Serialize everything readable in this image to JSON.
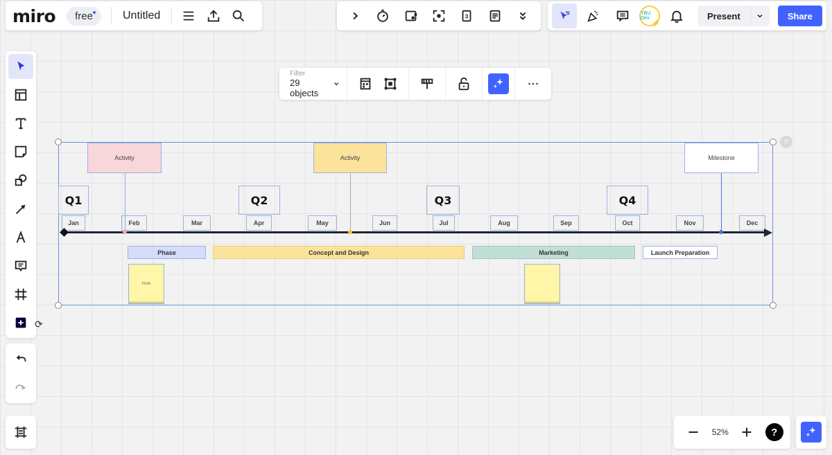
{
  "header": {
    "logo": "miro",
    "plan_badge": "free",
    "board_title": "Untitled",
    "left_icons": [
      "menu-icon",
      "upload-icon",
      "search-icon"
    ]
  },
  "center_toolbar": {
    "icons": [
      "chevron-right-icon",
      "timer-icon",
      "card-icon",
      "focus-icon",
      "calendar-icon",
      "notes-icon",
      "chevrons-down-icon"
    ]
  },
  "right_toolbar": {
    "icons": [
      "cursor-tracking-icon",
      "celebrate-icon",
      "comments-icon",
      "avatar",
      "bell-icon"
    ],
    "avatar_text": "YBU Dev",
    "present_label": "Present",
    "share_label": "Share",
    "accent_color": "#4262ff"
  },
  "context_toolbar": {
    "filter_label": "Filter",
    "filter_value": "29 objects",
    "icons": [
      "grid-layout-icon",
      "fit-frame-icon",
      "paint-format-icon",
      "unlock-icon",
      "ai-sparkle-icon",
      "more-icon"
    ]
  },
  "left_toolbar": {
    "tools": [
      "select-icon",
      "templates-icon",
      "text-icon",
      "sticky-note-icon",
      "shapes-icon",
      "arrow-icon",
      "pen-icon",
      "comment-icon",
      "frame-icon",
      "more-apps-icon"
    ],
    "active_tool": "select"
  },
  "history": {
    "undo": "undo-icon",
    "redo": "redo-icon"
  },
  "bottom_right": {
    "zoom_level": "52%",
    "help_label": "?"
  },
  "timeline": {
    "quarters": [
      "Q1",
      "Q2",
      "Q3",
      "Q4"
    ],
    "months": [
      "Jan",
      "Feb",
      "Mar",
      "Apr",
      "May",
      "Jun",
      "Jul",
      "Aug",
      "Sep",
      "Oct",
      "Nov",
      "Dec"
    ],
    "events": [
      {
        "label": "Activity",
        "color": "#f8d7da"
      },
      {
        "label": "Activity",
        "color": "#fbe39b"
      },
      {
        "label": "Milestone",
        "color": "#ffffff"
      }
    ],
    "phases": [
      {
        "label": "Phase",
        "color": "#d5dcfa"
      },
      {
        "label": "Concept and Design",
        "color": "#fbe39b"
      },
      {
        "label": "Marketing",
        "color": "#c2dfd7"
      },
      {
        "label": "Launch Preparation",
        "color": "#ffffff"
      }
    ],
    "notes": [
      {
        "label": "Note",
        "color": "#fff6a8"
      },
      {
        "label": "",
        "color": "#fff6a8"
      }
    ]
  }
}
